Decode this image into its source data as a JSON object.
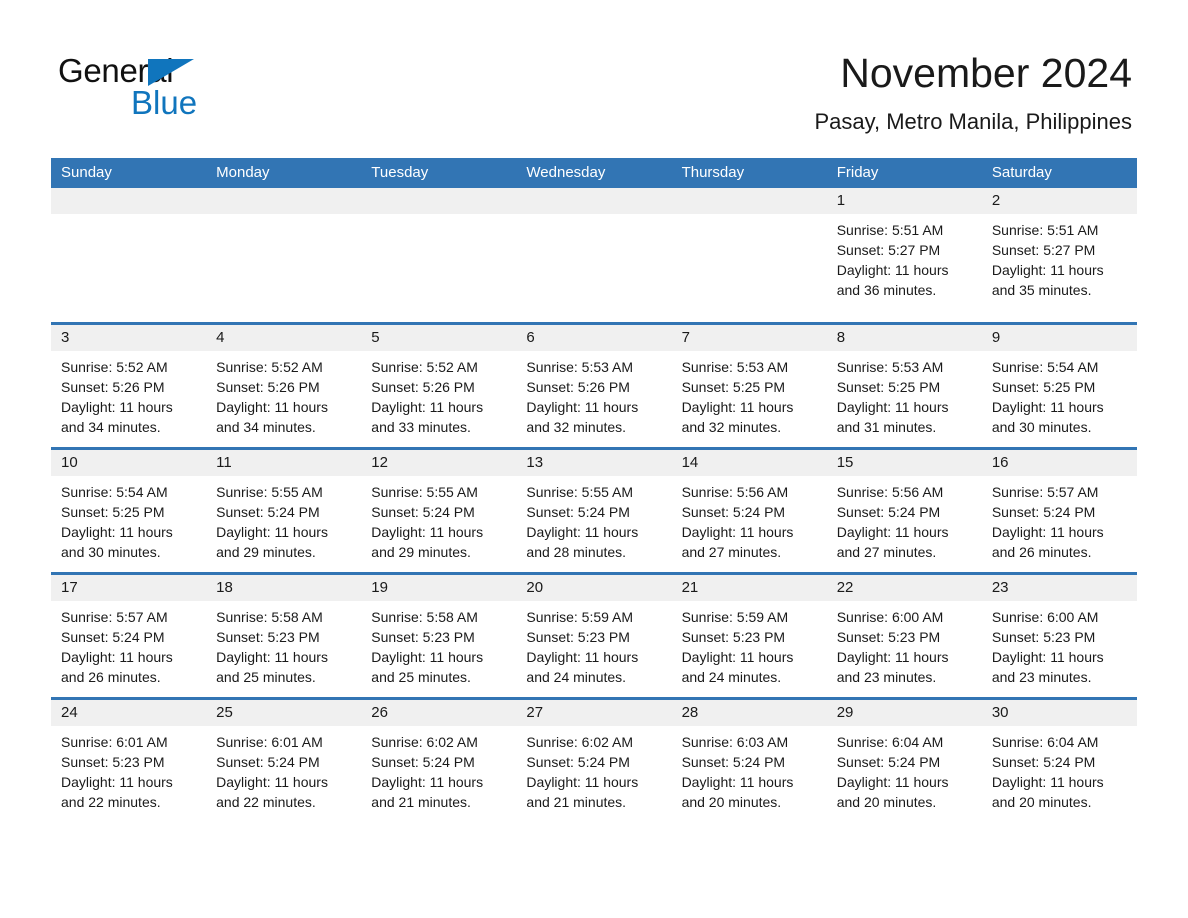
{
  "brand": {
    "word_general": "General",
    "word_blue": "Blue",
    "accent_color": "#1075bd"
  },
  "header": {
    "month_title": "November 2024",
    "location": "Pasay, Metro Manila, Philippines",
    "header_bar_color": "#3275b4"
  },
  "calendar": {
    "weekdays": [
      "Sunday",
      "Monday",
      "Tuesday",
      "Wednesday",
      "Thursday",
      "Friday",
      "Saturday"
    ],
    "weeks": [
      [
        {
          "day": "",
          "sunrise": "",
          "sunset": "",
          "daylight_line1": "",
          "daylight_line2": ""
        },
        {
          "day": "",
          "sunrise": "",
          "sunset": "",
          "daylight_line1": "",
          "daylight_line2": ""
        },
        {
          "day": "",
          "sunrise": "",
          "sunset": "",
          "daylight_line1": "",
          "daylight_line2": ""
        },
        {
          "day": "",
          "sunrise": "",
          "sunset": "",
          "daylight_line1": "",
          "daylight_line2": ""
        },
        {
          "day": "",
          "sunrise": "",
          "sunset": "",
          "daylight_line1": "",
          "daylight_line2": ""
        },
        {
          "day": "1",
          "sunrise": "Sunrise: 5:51 AM",
          "sunset": "Sunset: 5:27 PM",
          "daylight_line1": "Daylight: 11 hours",
          "daylight_line2": "and 36 minutes."
        },
        {
          "day": "2",
          "sunrise": "Sunrise: 5:51 AM",
          "sunset": "Sunset: 5:27 PM",
          "daylight_line1": "Daylight: 11 hours",
          "daylight_line2": "and 35 minutes."
        }
      ],
      [
        {
          "day": "3",
          "sunrise": "Sunrise: 5:52 AM",
          "sunset": "Sunset: 5:26 PM",
          "daylight_line1": "Daylight: 11 hours",
          "daylight_line2": "and 34 minutes."
        },
        {
          "day": "4",
          "sunrise": "Sunrise: 5:52 AM",
          "sunset": "Sunset: 5:26 PM",
          "daylight_line1": "Daylight: 11 hours",
          "daylight_line2": "and 34 minutes."
        },
        {
          "day": "5",
          "sunrise": "Sunrise: 5:52 AM",
          "sunset": "Sunset: 5:26 PM",
          "daylight_line1": "Daylight: 11 hours",
          "daylight_line2": "and 33 minutes."
        },
        {
          "day": "6",
          "sunrise": "Sunrise: 5:53 AM",
          "sunset": "Sunset: 5:26 PM",
          "daylight_line1": "Daylight: 11 hours",
          "daylight_line2": "and 32 minutes."
        },
        {
          "day": "7",
          "sunrise": "Sunrise: 5:53 AM",
          "sunset": "Sunset: 5:25 PM",
          "daylight_line1": "Daylight: 11 hours",
          "daylight_line2": "and 32 minutes."
        },
        {
          "day": "8",
          "sunrise": "Sunrise: 5:53 AM",
          "sunset": "Sunset: 5:25 PM",
          "daylight_line1": "Daylight: 11 hours",
          "daylight_line2": "and 31 minutes."
        },
        {
          "day": "9",
          "sunrise": "Sunrise: 5:54 AM",
          "sunset": "Sunset: 5:25 PM",
          "daylight_line1": "Daylight: 11 hours",
          "daylight_line2": "and 30 minutes."
        }
      ],
      [
        {
          "day": "10",
          "sunrise": "Sunrise: 5:54 AM",
          "sunset": "Sunset: 5:25 PM",
          "daylight_line1": "Daylight: 11 hours",
          "daylight_line2": "and 30 minutes."
        },
        {
          "day": "11",
          "sunrise": "Sunrise: 5:55 AM",
          "sunset": "Sunset: 5:24 PM",
          "daylight_line1": "Daylight: 11 hours",
          "daylight_line2": "and 29 minutes."
        },
        {
          "day": "12",
          "sunrise": "Sunrise: 5:55 AM",
          "sunset": "Sunset: 5:24 PM",
          "daylight_line1": "Daylight: 11 hours",
          "daylight_line2": "and 29 minutes."
        },
        {
          "day": "13",
          "sunrise": "Sunrise: 5:55 AM",
          "sunset": "Sunset: 5:24 PM",
          "daylight_line1": "Daylight: 11 hours",
          "daylight_line2": "and 28 minutes."
        },
        {
          "day": "14",
          "sunrise": "Sunrise: 5:56 AM",
          "sunset": "Sunset: 5:24 PM",
          "daylight_line1": "Daylight: 11 hours",
          "daylight_line2": "and 27 minutes."
        },
        {
          "day": "15",
          "sunrise": "Sunrise: 5:56 AM",
          "sunset": "Sunset: 5:24 PM",
          "daylight_line1": "Daylight: 11 hours",
          "daylight_line2": "and 27 minutes."
        },
        {
          "day": "16",
          "sunrise": "Sunrise: 5:57 AM",
          "sunset": "Sunset: 5:24 PM",
          "daylight_line1": "Daylight: 11 hours",
          "daylight_line2": "and 26 minutes."
        }
      ],
      [
        {
          "day": "17",
          "sunrise": "Sunrise: 5:57 AM",
          "sunset": "Sunset: 5:24 PM",
          "daylight_line1": "Daylight: 11 hours",
          "daylight_line2": "and 26 minutes."
        },
        {
          "day": "18",
          "sunrise": "Sunrise: 5:58 AM",
          "sunset": "Sunset: 5:23 PM",
          "daylight_line1": "Daylight: 11 hours",
          "daylight_line2": "and 25 minutes."
        },
        {
          "day": "19",
          "sunrise": "Sunrise: 5:58 AM",
          "sunset": "Sunset: 5:23 PM",
          "daylight_line1": "Daylight: 11 hours",
          "daylight_line2": "and 25 minutes."
        },
        {
          "day": "20",
          "sunrise": "Sunrise: 5:59 AM",
          "sunset": "Sunset: 5:23 PM",
          "daylight_line1": "Daylight: 11 hours",
          "daylight_line2": "and 24 minutes."
        },
        {
          "day": "21",
          "sunrise": "Sunrise: 5:59 AM",
          "sunset": "Sunset: 5:23 PM",
          "daylight_line1": "Daylight: 11 hours",
          "daylight_line2": "and 24 minutes."
        },
        {
          "day": "22",
          "sunrise": "Sunrise: 6:00 AM",
          "sunset": "Sunset: 5:23 PM",
          "daylight_line1": "Daylight: 11 hours",
          "daylight_line2": "and 23 minutes."
        },
        {
          "day": "23",
          "sunrise": "Sunrise: 6:00 AM",
          "sunset": "Sunset: 5:23 PM",
          "daylight_line1": "Daylight: 11 hours",
          "daylight_line2": "and 23 minutes."
        }
      ],
      [
        {
          "day": "24",
          "sunrise": "Sunrise: 6:01 AM",
          "sunset": "Sunset: 5:23 PM",
          "daylight_line1": "Daylight: 11 hours",
          "daylight_line2": "and 22 minutes."
        },
        {
          "day": "25",
          "sunrise": "Sunrise: 6:01 AM",
          "sunset": "Sunset: 5:24 PM",
          "daylight_line1": "Daylight: 11 hours",
          "daylight_line2": "and 22 minutes."
        },
        {
          "day": "26",
          "sunrise": "Sunrise: 6:02 AM",
          "sunset": "Sunset: 5:24 PM",
          "daylight_line1": "Daylight: 11 hours",
          "daylight_line2": "and 21 minutes."
        },
        {
          "day": "27",
          "sunrise": "Sunrise: 6:02 AM",
          "sunset": "Sunset: 5:24 PM",
          "daylight_line1": "Daylight: 11 hours",
          "daylight_line2": "and 21 minutes."
        },
        {
          "day": "28",
          "sunrise": "Sunrise: 6:03 AM",
          "sunset": "Sunset: 5:24 PM",
          "daylight_line1": "Daylight: 11 hours",
          "daylight_line2": "and 20 minutes."
        },
        {
          "day": "29",
          "sunrise": "Sunrise: 6:04 AM",
          "sunset": "Sunset: 5:24 PM",
          "daylight_line1": "Daylight: 11 hours",
          "daylight_line2": "and 20 minutes."
        },
        {
          "day": "30",
          "sunrise": "Sunrise: 6:04 AM",
          "sunset": "Sunset: 5:24 PM",
          "daylight_line1": "Daylight: 11 hours",
          "daylight_line2": "and 20 minutes."
        }
      ]
    ]
  }
}
